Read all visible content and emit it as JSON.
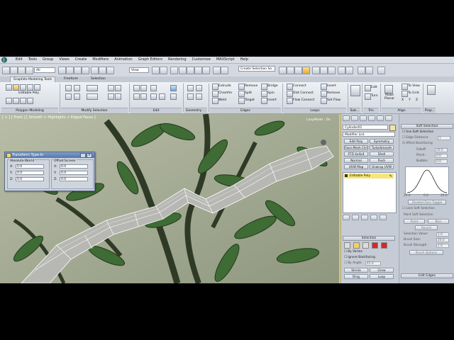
{
  "menu": {
    "items": [
      "Edit",
      "Tools",
      "Group",
      "Views",
      "Create",
      "Modifiers",
      "Animation",
      "Graph Editors",
      "Rendering",
      "Customize",
      "MAXScript",
      "Help"
    ]
  },
  "toolbar": {
    "filter_value": "All",
    "ref_coord_value": "View",
    "selection_set_placeholder": "Create Selection Se"
  },
  "ribbon": {
    "tabs": [
      "Graphite Modeling Tools",
      "Freeform",
      "Selection"
    ],
    "poly_modeling": {
      "label": "Polygon Modeling",
      "editable_poly": "Editable Poly"
    },
    "panels": [
      "Polygon Modeling",
      "Modify Selection",
      "Edit",
      "Geometry ...",
      "Edges",
      "Loops",
      "Sub...",
      "Tris",
      "Align",
      "Prop..."
    ],
    "edges": {
      "col1": [
        "Extrude",
        "Chamfer",
        "Weld"
      ],
      "col2": [
        "Remove",
        "Split",
        "Target"
      ],
      "col3": [
        "Bridge",
        "Spin",
        "Insert"
      ]
    },
    "loops": {
      "col1": [
        "Connect",
        "Dist Connect",
        "Flow Connect"
      ],
      "col2": [
        "Insert",
        "Remove",
        "Set Flow"
      ]
    },
    "tris": [
      "Edit",
      "Turn"
    ],
    "make_planar": "Make Planar",
    "align": [
      "To View",
      "To Grid",
      "X",
      "Y",
      "Z"
    ]
  },
  "viewport": {
    "label": "[ + ] [ Front ] [ Smooth + Highlights + Edged Faces ]",
    "loop_mode": "LoopMode : On"
  },
  "transform_dialog": {
    "title": "Transform Type-In",
    "absolute_group": "Absolute:World",
    "offset_group": "Offset:Screen",
    "absolute": [
      {
        "axis": "X:",
        "value": "0.0"
      },
      {
        "axis": "Y:",
        "value": "0.0"
      },
      {
        "axis": "Z:",
        "value": "0.0"
      }
    ],
    "offset": [
      {
        "axis": "X:",
        "value": "0.0"
      },
      {
        "axis": "Y:",
        "value": "0.0"
      },
      {
        "axis": "Z:",
        "value": "0.0"
      }
    ]
  },
  "command_panel": {
    "object_name": "Cylinder01",
    "modifier_list": "Modifier List",
    "buttons": [
      [
        "Edit Poly",
        "Symmetry"
      ],
      [
        "Face Mesh Ctrl",
        "TurboSmooth"
      ],
      [
        "FFD 4x4x4",
        "Shell"
      ],
      [
        "Normal",
        "Push"
      ],
      [
        "UVW Map",
        "Unwrap UVW"
      ]
    ],
    "stack_item": "Editable Poly",
    "selection_title": "Selection",
    "by_vertex": "By Vertex",
    "ignore_backfacing": "Ignore Backfacing",
    "by_angle": "By Angle:",
    "by_angle_value": "45.0",
    "shrink": "Shrink",
    "grow": "Grow",
    "ring": "Ring",
    "loop": "Loop"
  },
  "rollout": {
    "soft_selection": "Soft Selection",
    "use_soft_selection": "Use Soft Selection",
    "edge_distance": "Edge Distance:",
    "edge_distance_value": "1",
    "affect_backfacing": "Affect Backfacing",
    "falloff": "Falloff:",
    "falloff_value": "20.0",
    "pinch": "Pinch:",
    "pinch_value": "0.0",
    "bubble": "Bubble:",
    "bubble_value": "0.0",
    "curve_labels": [
      "20.0",
      "0.0",
      "20.0"
    ],
    "shaded_face_toggle": "Shaded Face Toggle",
    "lock_soft_selection": "Lock Soft Selection",
    "paint_soft_selection": "Paint Soft Selection",
    "paint": "Paint",
    "blur": "Blur",
    "revert": "Revert",
    "selection_value": "Selection Value:",
    "selection_value_value": "1.0",
    "brush_size": "Brush Size:",
    "brush_size_value": "20.0",
    "brush_strength": "Brush Strength:",
    "brush_strength_value": "1.0",
    "brush_options": "Brush Options",
    "edit_edges": "Edit Edges"
  }
}
